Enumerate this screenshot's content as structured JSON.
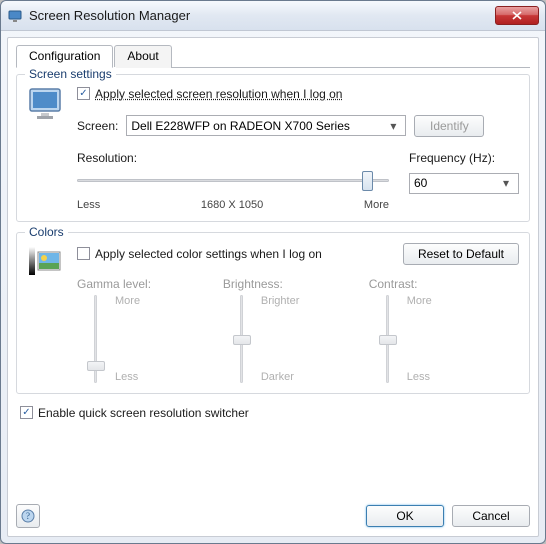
{
  "title": "Screen Resolution Manager",
  "tabs": {
    "config": "Configuration",
    "about": "About"
  },
  "screen": {
    "group_title": "Screen settings",
    "apply_logon_label": "Apply selected screen resolution when I log on",
    "apply_logon_checked": true,
    "screen_label": "Screen:",
    "screen_value": "Dell E228WFP on RADEON X700 Series",
    "identify_label": "Identify",
    "resolution_label": "Resolution:",
    "res_less": "Less",
    "res_value": "1680 X 1050",
    "res_more": "More",
    "frequency_label": "Frequency (Hz):",
    "frequency_value": "60"
  },
  "colors": {
    "group_title": "Colors",
    "apply_logon_label": "Apply selected color settings when I log on",
    "apply_logon_checked": false,
    "reset_label": "Reset to Default",
    "gamma": {
      "title": "Gamma level:",
      "top": "More",
      "bottom": "Less"
    },
    "brightness": {
      "title": "Brightness:",
      "top": "Brighter",
      "bottom": "Darker"
    },
    "contrast": {
      "title": "Contrast:",
      "top": "More",
      "bottom": "Less"
    }
  },
  "switcher": {
    "label": "Enable quick screen resolution switcher",
    "checked": true
  },
  "buttons": {
    "ok": "OK",
    "cancel": "Cancel",
    "help": "?"
  }
}
